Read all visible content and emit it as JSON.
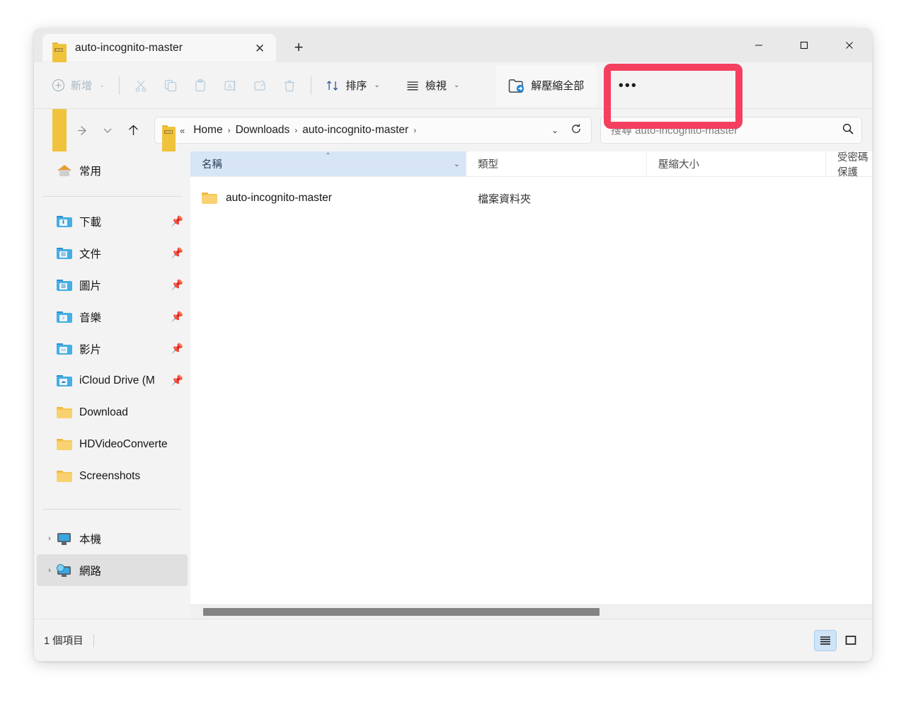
{
  "window": {
    "tab_title": "auto-incognito-master",
    "tab_icon": "zip-folder-icon",
    "close_tab_glyph": "✕",
    "new_tab_glyph": "+",
    "minimize_glyph": "—",
    "maximize_glyph": "▢",
    "close_glyph": "✕"
  },
  "toolbar": {
    "new_label": "新增",
    "new_glyph": "⊕",
    "cut_glyph": "✂",
    "copy_glyph": "⧉",
    "paste_glyph": "📋",
    "rename_glyph": "A",
    "share_glyph": "↗",
    "delete_glyph": "🗑",
    "sort_label": "排序",
    "sort_glyph": "↑↓",
    "view_label": "檢視",
    "view_glyph": "≡",
    "extract_all_label": "解壓縮全部",
    "extract_all_glyph": "folder-extract-icon",
    "more_glyph": "•••",
    "chevron": "⌄",
    "highlight_color": "#f53f5f"
  },
  "navbar": {
    "back_glyph": "←",
    "forward_glyph": "→",
    "recent_glyph": "⌄",
    "up_glyph": "↑",
    "breadcrumb_overflow": "«",
    "breadcrumbs": [
      "Home",
      "Downloads",
      "auto-incognito-master"
    ],
    "separator": "›",
    "dropdown_glyph": "⌄",
    "refresh_glyph": "⟳",
    "search_placeholder": "搜尋 auto-incognito-master",
    "search_value": "",
    "search_glyph": "🔎"
  },
  "sidebar": {
    "home": {
      "label": "常用",
      "icon": "home-icon"
    },
    "quick_access": [
      {
        "label": "下載",
        "icon": "blue-folder-download-icon",
        "pinned": true,
        "pin_glyph": "📌"
      },
      {
        "label": "文件",
        "icon": "blue-folder-documents-icon",
        "pinned": true,
        "pin_glyph": "📌"
      },
      {
        "label": "圖片",
        "icon": "blue-folder-pictures-icon",
        "pinned": true,
        "pin_glyph": "📌"
      },
      {
        "label": "音樂",
        "icon": "blue-folder-music-icon",
        "pinned": true,
        "pin_glyph": "📌"
      },
      {
        "label": "影片",
        "icon": "blue-folder-videos-icon",
        "pinned": true,
        "pin_glyph": "📌"
      },
      {
        "label": "iCloud Drive (M",
        "icon": "blue-folder-cloud-icon",
        "pinned": true,
        "pin_glyph": "📌"
      },
      {
        "label": "Download",
        "icon": "yellow-folder-icon",
        "pinned": false,
        "pin_glyph": ""
      },
      {
        "label": "HDVideoConverte",
        "icon": "yellow-folder-icon",
        "pinned": false,
        "pin_glyph": ""
      },
      {
        "label": "Screenshots",
        "icon": "yellow-folder-icon",
        "pinned": false,
        "pin_glyph": ""
      }
    ],
    "trees": [
      {
        "label": "本機",
        "icon": "this-pc-icon",
        "expander": "›",
        "highlighted": false
      },
      {
        "label": "網路",
        "icon": "network-icon",
        "expander": "›",
        "highlighted": true
      }
    ]
  },
  "filepane": {
    "columns": [
      {
        "label": "名稱",
        "active": true,
        "sort_glyph": "⌃",
        "dropdown_glyph": "⌄"
      },
      {
        "label": "類型",
        "active": false,
        "sort_glyph": "",
        "dropdown_glyph": ""
      },
      {
        "label": "壓縮大小",
        "active": false,
        "sort_glyph": "",
        "dropdown_glyph": ""
      },
      {
        "label": "受密碼保護",
        "active": false,
        "sort_glyph": "",
        "dropdown_glyph": ""
      }
    ],
    "rows": [
      {
        "name": "auto-incognito-master",
        "icon": "yellow-folder-icon",
        "type": "檔案資料夾",
        "compressed_size": "",
        "protected": ""
      }
    ]
  },
  "statusbar": {
    "item_count": "1 個項目",
    "details_view_glyph": "≣",
    "icons_view_glyph": "▢"
  }
}
